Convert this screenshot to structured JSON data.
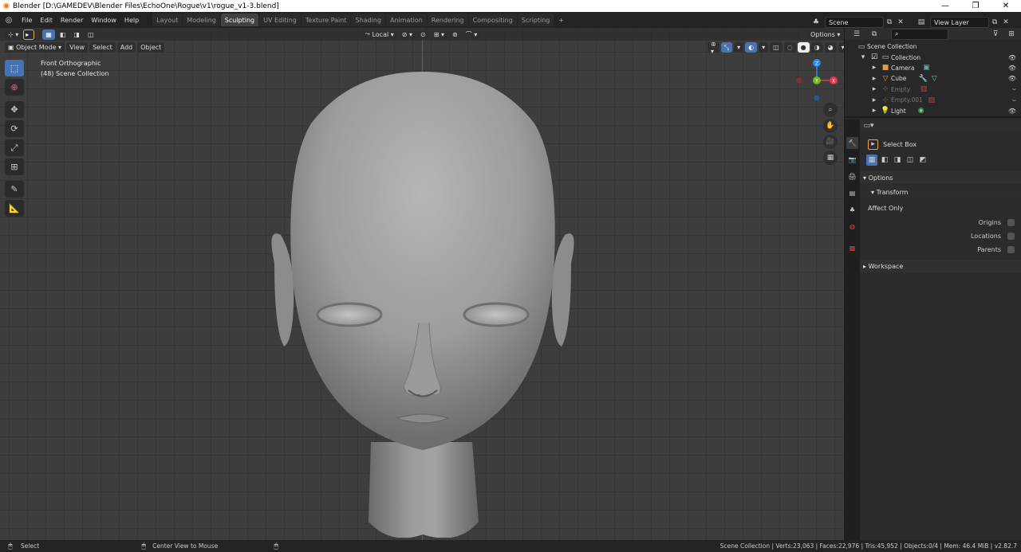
{
  "window": {
    "title": "Blender [D:\\GAMEDEV\\Blender Files\\EchoOne\\Rogue\\v1\\rogue_v1-3.blend]",
    "controls": [
      "—",
      "❐",
      "✕"
    ]
  },
  "menubar": {
    "items": [
      "File",
      "Edit",
      "Render",
      "Window",
      "Help"
    ],
    "tabs": [
      "Layout",
      "Modeling",
      "Sculpting",
      "UV Editing",
      "Texture Paint",
      "Shading",
      "Animation",
      "Rendering",
      "Compositing",
      "Scripting"
    ],
    "active_tab": "Sculpting",
    "add_tab": "+",
    "scene": "Scene",
    "view_layer": "View Layer"
  },
  "viewport": {
    "transform_orientation": "Local",
    "options_label": "Options",
    "mode": "Object Mode",
    "header_menu": [
      "View",
      "Select",
      "Add",
      "Object"
    ],
    "view_name": "Front Orthographic",
    "collection_info": "(48) Scene Collection",
    "gizmo": {
      "z": "Z",
      "y": "Y",
      "x": "X"
    }
  },
  "outliner": {
    "search_placeholder": "",
    "root": "Scene Collection",
    "collection": "Collection",
    "items": [
      {
        "label": "Camera",
        "dim": false
      },
      {
        "label": "Cube",
        "dim": false
      },
      {
        "label": "Empty",
        "dim": true
      },
      {
        "label": "Empty.001",
        "dim": true
      },
      {
        "label": "Light",
        "dim": false
      }
    ]
  },
  "properties": {
    "tool_name": "Select Box",
    "options_panel": "Options",
    "transform_panel": "Transform",
    "affect_only_label": "Affect Only",
    "checkboxes": [
      "Origins",
      "Locations",
      "Parents"
    ],
    "workspace_panel": "Workspace"
  },
  "statusbar": {
    "left_action": "Select",
    "middle_action": "Center View to Mouse",
    "stats": "Scene Collection | Verts:23,063 | Faces:22,976 | Tris:45,952 | Objects:0/4 | Mem: 46.4 MiB | v2.82.7"
  },
  "colors": {
    "accent_blue": "#4772b3",
    "viewport_bg": "#3d3d3d",
    "axis_x": "#e8364e",
    "axis_y": "#6fb824",
    "axis_z": "#2d8cea"
  }
}
